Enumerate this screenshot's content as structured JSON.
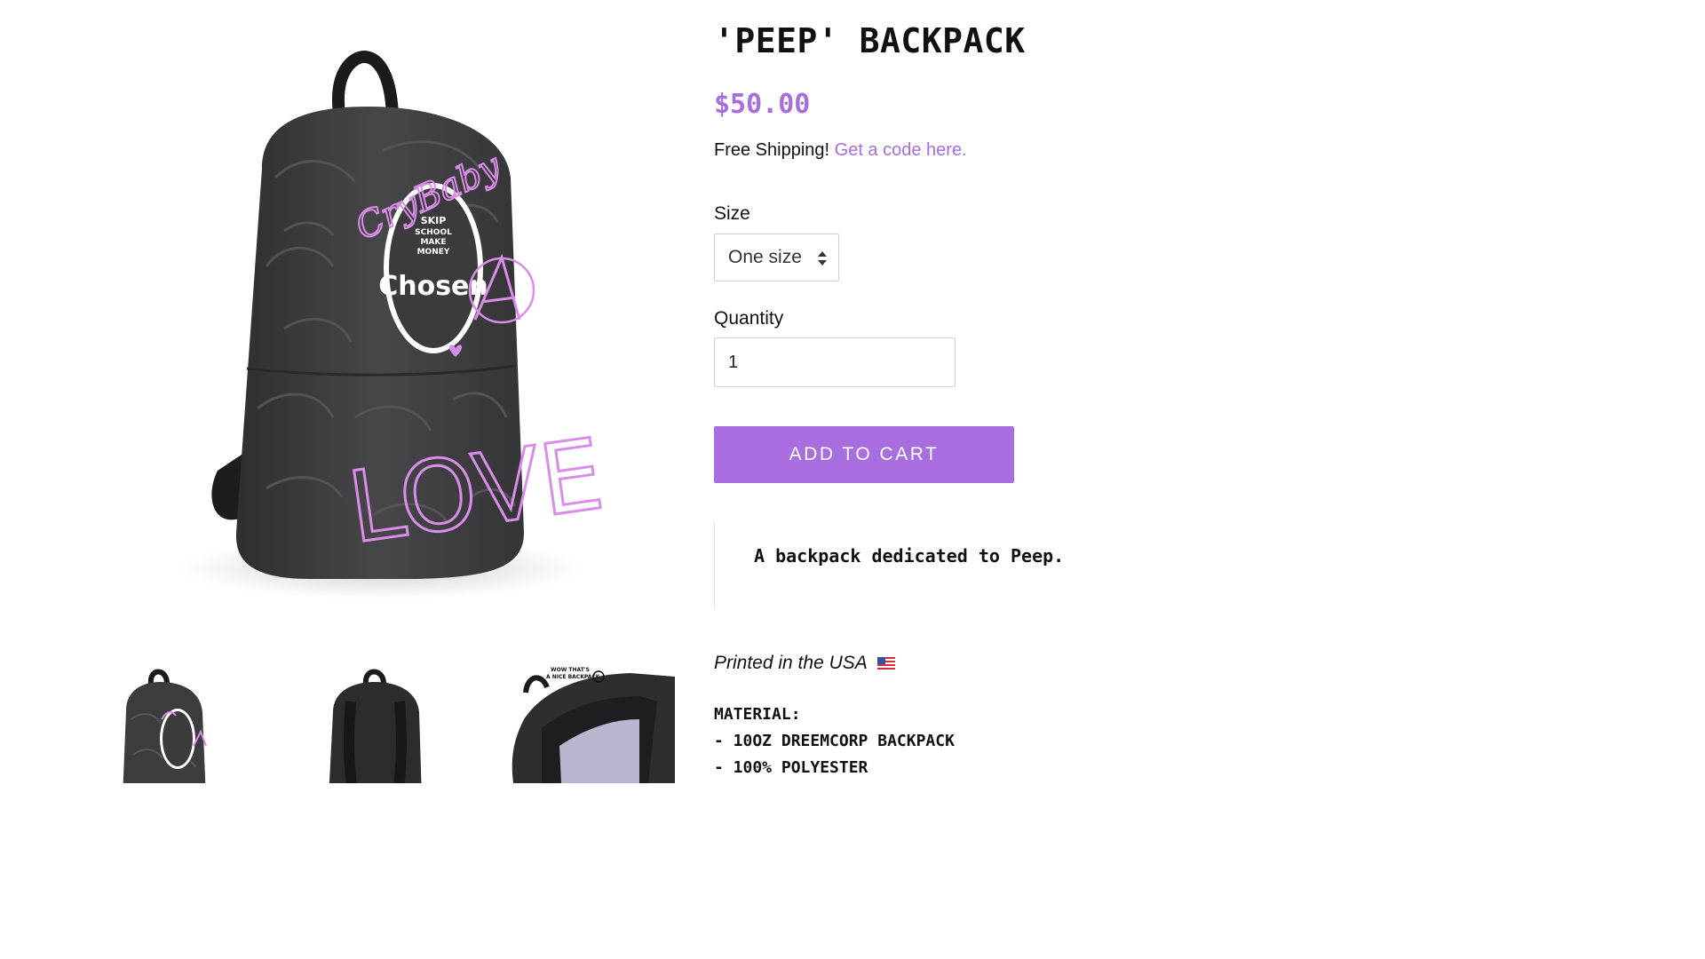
{
  "product": {
    "title": "'PEEP' BACKPACK",
    "price": "$50.00",
    "shipping_text": "Free Shipping!",
    "shipping_link": "Get a code here.",
    "size_label": "Size",
    "size_value": "One size",
    "quantity_label": "Quantity",
    "quantity_value": "1",
    "add_to_cart_label": "ADD TO CART",
    "quote": "A backpack dedicated to Peep.",
    "printed_text": "Printed in the USA",
    "material_heading": "MATERIAL:",
    "material_lines": [
      "- 10OZ DREEMCORP BACKPACK",
      "- 100% POLYESTER"
    ]
  },
  "gallery": {
    "main_image_text": {
      "signature": "CryBaby",
      "badge_line_1": "SKIP",
      "badge_line_2": "SCHOOL",
      "badge_line_3": "MAKE",
      "badge_line_4": "MONEY",
      "badge_brand": "Chosen",
      "graffiti": "LOVE"
    },
    "thumb3_text_line_1": "WOW THAT'S",
    "thumb3_text_line_2": "A NICE BACKPACK"
  },
  "colors": {
    "accent": "#a86ee0",
    "backpack": "#3c3c3e",
    "graffiti": "#d98de8"
  },
  "icons": [
    "select-arrows-icon",
    "us-flag-icon"
  ]
}
